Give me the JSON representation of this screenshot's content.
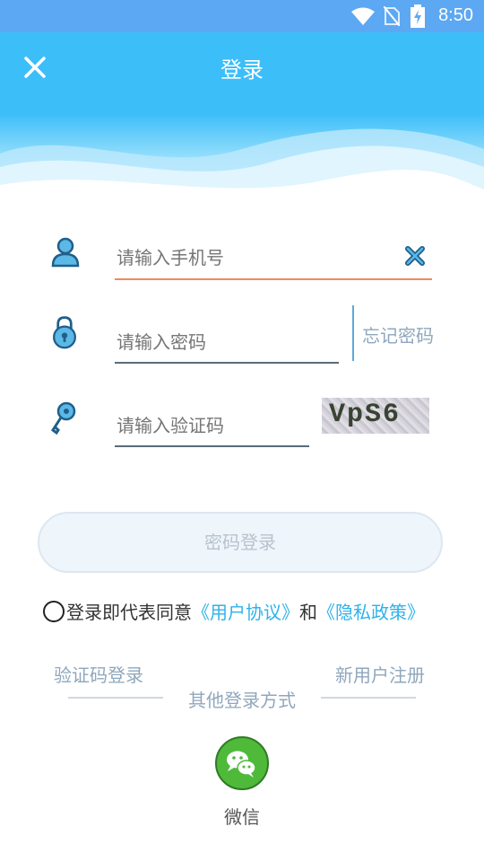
{
  "status_bar": {
    "time": "8:50"
  },
  "header": {
    "title": "登录"
  },
  "form": {
    "phone_placeholder": "请输入手机号",
    "password_placeholder": "请输入密码",
    "forgot_password": "忘记密码",
    "captcha_placeholder": "请输入验证码",
    "captcha_text": "VpS6"
  },
  "login_button": "密码登录",
  "agreement": {
    "prefix": "登录即代表同意",
    "user_agreement": "《用户协议》",
    "and": "和",
    "privacy_policy": "《隐私政策》"
  },
  "links": {
    "sms_login": "验证码登录",
    "register": "新用户注册"
  },
  "other_login": {
    "title": "其他登录方式",
    "wechat_label": "微信"
  },
  "colors": {
    "header": "#3cbef9",
    "active_underline": "#f08a5d",
    "link": "#2fb2ea",
    "wechat": "#4fba3a"
  }
}
